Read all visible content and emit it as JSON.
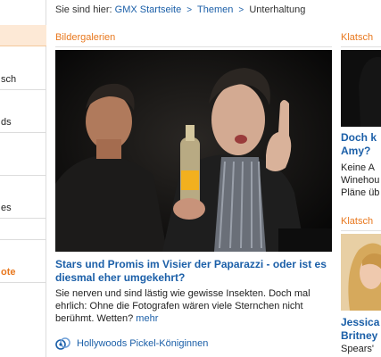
{
  "sidebar": {
    "items": [
      {
        "label": ""
      },
      {
        "label": "sch"
      },
      {
        "label": "ds"
      },
      {
        "label": ""
      },
      {
        "label": "es"
      },
      {
        "label": ""
      },
      {
        "label": "ote"
      }
    ]
  },
  "breadcrumb": {
    "prefix": "Sie sind hier:",
    "items": [
      "GMX Startseite",
      "Themen",
      "Unterhaltung"
    ]
  },
  "main": {
    "section_title": "Bildergalerien",
    "headline": "Stars und Promis im Visier der Paparazzi - oder ist es diesmal eher umgekehrt?",
    "teaser": "Sie nerven und sind lästig wie gewisse Insekten. Doch mal ehrlich: Ohne die Fotografen wären viele Sternchen nicht berühmt. Wetten?",
    "more_label": "mehr",
    "related_link": "Hollywoods Pickel-Königinnen"
  },
  "right": {
    "section1_title": "Klatsch",
    "item1_title_line1": "Doch k",
    "item1_title_line2": "Amy?",
    "item1_text_lines": [
      "Keine A",
      "Winehou",
      "Pläne üb"
    ],
    "section2_title": "Klatsch",
    "item2_title_line1": "Jessica",
    "item2_title_line2": "Britney",
    "item2_text_line1": "Spears'"
  },
  "colors": {
    "accent": "#e8781e",
    "link": "#1b5fa8",
    "active_bg": "#fde9d6"
  }
}
